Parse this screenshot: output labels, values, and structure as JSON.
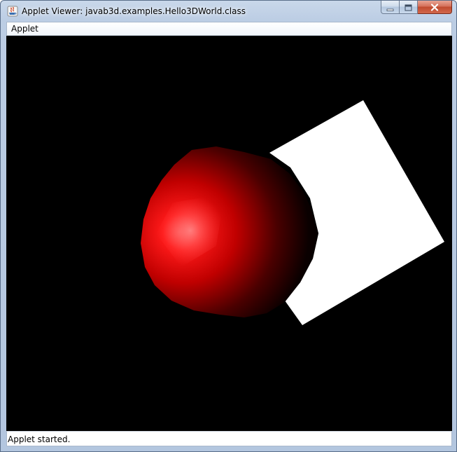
{
  "window": {
    "title": "Applet Viewer: javab3d.examples.Hello3DWorld.class"
  },
  "menubar": {
    "items": [
      {
        "label": "Applet"
      }
    ]
  },
  "canvas": {
    "background": "#000000",
    "sphere_color": "#ff0000",
    "plane_color": "#ffffff"
  },
  "status": {
    "text": "Applet started."
  },
  "icons": {
    "app": "java-cup-icon",
    "minimize": "minimize-icon",
    "maximize": "maximize-icon",
    "close": "close-icon"
  }
}
